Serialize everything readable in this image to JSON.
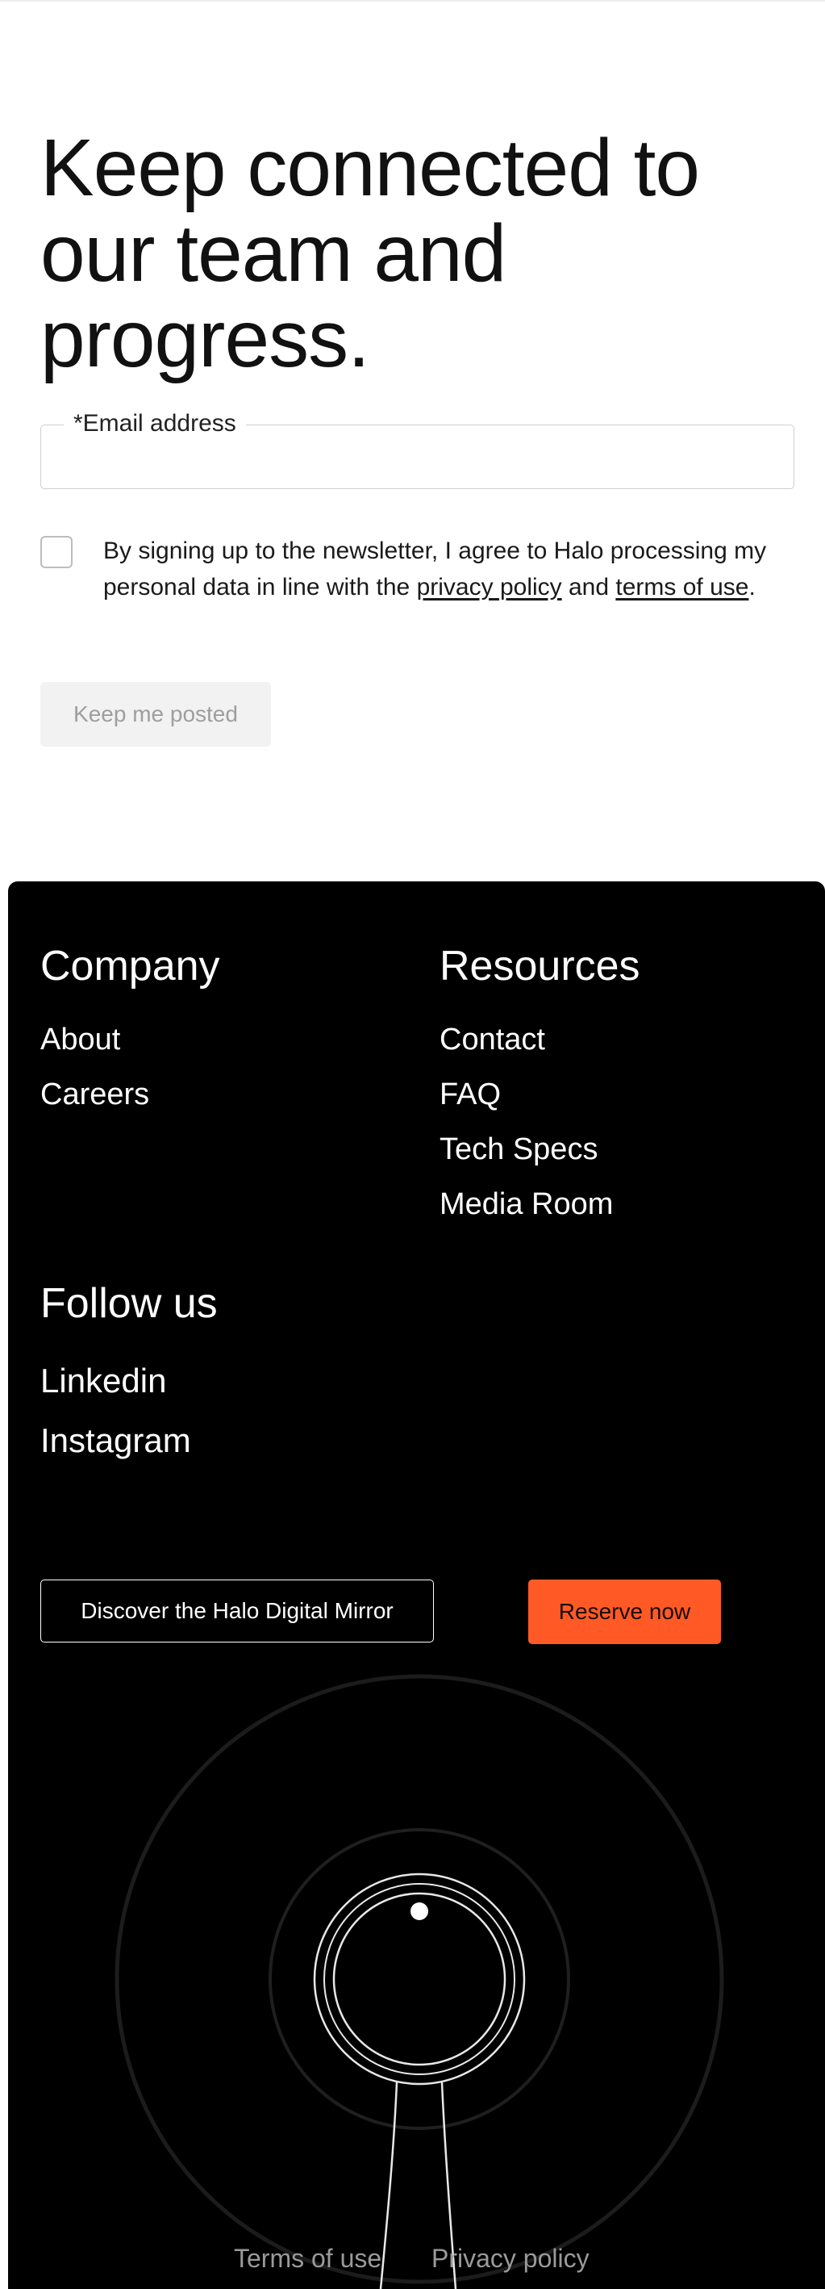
{
  "newsletter": {
    "headline_lines": [
      "Keep connected to",
      "our team and",
      "progress."
    ],
    "email_label": "*Email address",
    "email_value": "",
    "consent_prefix": "By signing up to the newsletter, I agree to Halo processing my personal data in line with the ",
    "privacy_link": "privacy policy",
    "consent_middle": " and ",
    "terms_link": "terms of use",
    "consent_suffix": ".",
    "submit_label": "Keep me posted"
  },
  "footer": {
    "company": {
      "title": "Company",
      "links": [
        "About",
        "Careers"
      ]
    },
    "resources": {
      "title": "Resources",
      "links": [
        "Contact",
        "FAQ",
        "Tech Specs",
        "Media Room"
      ]
    },
    "follow": {
      "title": "Follow us",
      "links": [
        "Linkedin",
        "Instagram"
      ]
    },
    "discover_label": "Discover the Halo Digital Mirror",
    "reserve_label": "Reserve now",
    "legal": {
      "terms": "Terms of use",
      "privacy": "Privacy policy"
    }
  },
  "colors": {
    "accent": "#ff5a26",
    "footer_bg": "#000000",
    "disabled_button_bg": "#f2f2f2",
    "legal_text": "#9a9a9a"
  },
  "icons": {
    "checkbox": "empty-checkbox",
    "illustration": "halo-mirror-line-illustration"
  }
}
